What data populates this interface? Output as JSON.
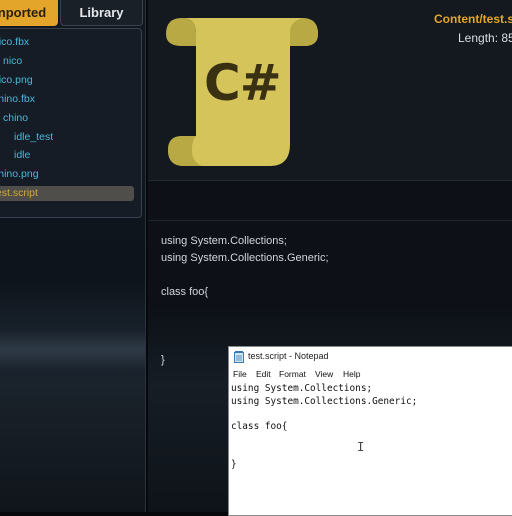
{
  "tabs": {
    "imported": "nported",
    "library": "Library"
  },
  "tree": [
    {
      "label": "nico.fbx",
      "indent": 0
    },
    {
      "label": "nico",
      "indent": 1
    },
    {
      "label": "nico.png",
      "indent": 0
    },
    {
      "label": "chino.fbx",
      "indent": 0
    },
    {
      "label": "chino",
      "indent": 1
    },
    {
      "label": "idle_test",
      "indent": 2
    },
    {
      "label": "idle",
      "indent": 2
    },
    {
      "label": "chino.png",
      "indent": 0
    },
    {
      "label": "test.script",
      "indent": 0,
      "selected": true
    }
  ],
  "preview": {
    "file_title": "Content/test.s",
    "length_label": "Length: 85",
    "icon_text": "C#",
    "icon_name": "csharp-script-icon",
    "icon_color": "#d4c45a"
  },
  "script_lines": [
    "using System.Collections;",
    "using System.Collections.Generic;",
    "",
    "class foo{",
    "",
    "",
    "",
    "}"
  ],
  "notepad": {
    "title": "test.script - Notepad",
    "menu": [
      "File",
      "Edit",
      "Format",
      "View",
      "Help"
    ],
    "lines": [
      "using System.Collections;",
      "using System.Collections.Generic;",
      "",
      "class foo{",
      "",
      "",
      "}"
    ]
  },
  "colors": {
    "accent": "#e3a52a",
    "tree_text": "#48b8d8"
  }
}
